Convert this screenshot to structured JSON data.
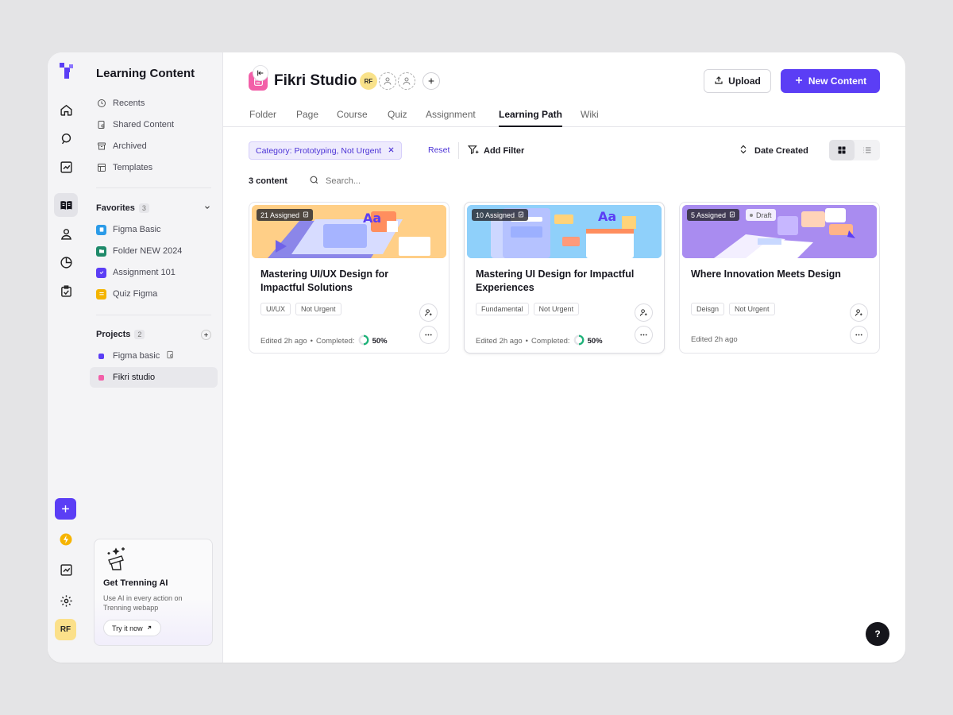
{
  "sidebar": {
    "title": "Learning Content",
    "nav": [
      {
        "label": "Recents",
        "icon": "clock-icon"
      },
      {
        "label": "Shared Content",
        "icon": "shared-icon"
      },
      {
        "label": "Archived",
        "icon": "archive-icon"
      },
      {
        "label": "Templates",
        "icon": "template-icon"
      }
    ],
    "favorites": {
      "label": "Favorites",
      "count": "3",
      "items": [
        {
          "label": "Figma Basic",
          "color": "#2b9be8"
        },
        {
          "label": "Folder NEW 2024",
          "color": "#1f8a6a"
        },
        {
          "label": "Assignment 101",
          "color": "#5b3ef5"
        },
        {
          "label": "Quiz Figma",
          "color": "#f4b400"
        }
      ]
    },
    "projects": {
      "label": "Projects",
      "count": "2",
      "items": [
        {
          "label": "Figma basic",
          "color": "#5b3ef5"
        },
        {
          "label": "Fikri studio",
          "color": "#f25fa8"
        }
      ]
    },
    "ai_card": {
      "title": "Get Trenning AI",
      "description": "Use AI in every action on Trenning webapp",
      "button": "Try it now"
    }
  },
  "rail": {
    "avatar_initials": "RF"
  },
  "header": {
    "workspace_name": "Fikri Studio",
    "member_initials": "RF",
    "upload_label": "Upload",
    "new_content_label": "New Content"
  },
  "tabs": [
    {
      "label": "Folder"
    },
    {
      "label": "Page"
    },
    {
      "label": "Course"
    },
    {
      "label": "Quiz"
    },
    {
      "label": "Assignment"
    },
    {
      "label": "Learning Path",
      "active": true
    },
    {
      "label": "Wiki"
    }
  ],
  "filters": {
    "chip_label": "Category: Prototyping, Not Urgent",
    "reset_label": "Reset",
    "add_filter_label": "Add Filter",
    "sort_label": "Date Created",
    "view": "grid"
  },
  "content": {
    "count_label": "3 content",
    "search_placeholder": "Search..."
  },
  "cards": [
    {
      "badge": "21 Assigned",
      "title": "Mastering UI/UX Design for Impactful Solutions",
      "tags": [
        "UI/UX",
        "Not Urgent"
      ],
      "edited": "Edited 2h ago",
      "completed_label": "Completed:",
      "completed": "50%"
    },
    {
      "badge": "10 Assigned",
      "title": "Mastering UI Design for Impactful Experiences",
      "tags": [
        "Fundamental",
        "Not Urgent"
      ],
      "edited": "Edited 2h ago",
      "completed_label": "Completed:",
      "completed": "50%"
    },
    {
      "badge": "5 Assigned",
      "draft": "Draft",
      "title": "Where Innovation Meets Design",
      "tags": [
        "Deisgn",
        "Not Urgent"
      ],
      "edited": "Edited 2h ago"
    }
  ],
  "help_label": "?"
}
